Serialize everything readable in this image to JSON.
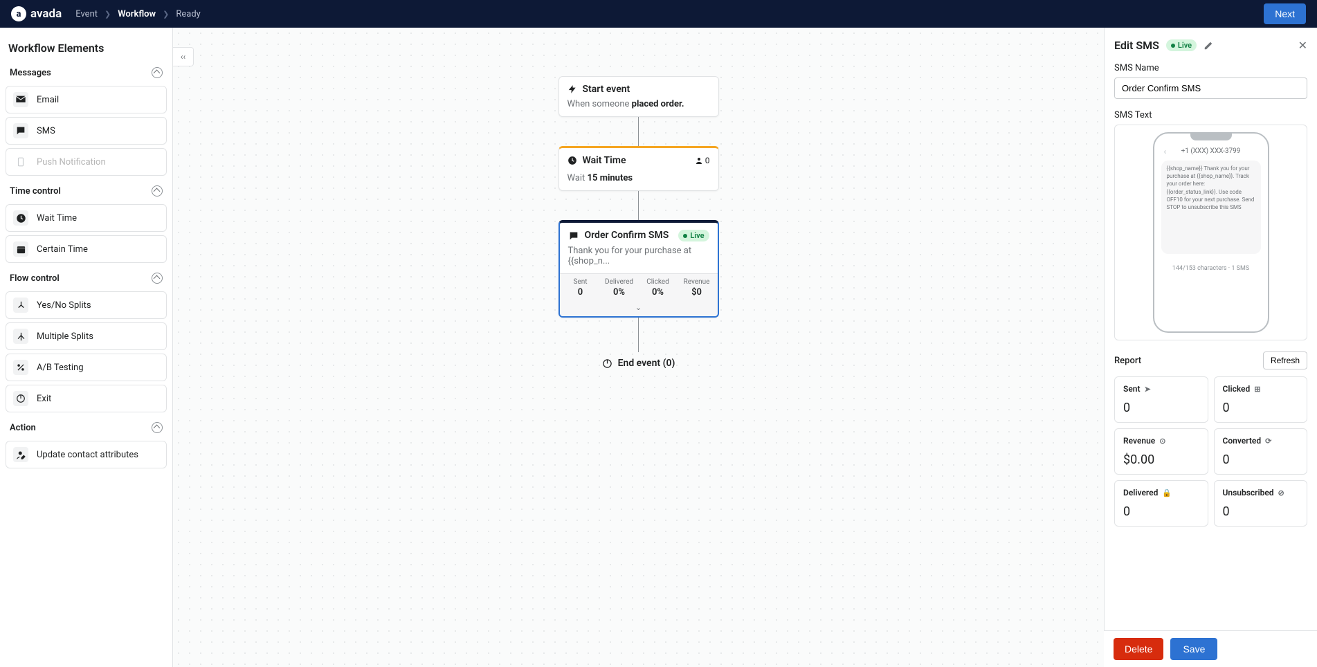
{
  "header": {
    "logo": "avada",
    "breadcrumbs": [
      "Event",
      "Workflow",
      "Ready"
    ],
    "next_button": "Next"
  },
  "sidebar": {
    "title": "Workflow Elements",
    "sections": [
      {
        "title": "Messages",
        "items": [
          {
            "label": "Email",
            "icon": "email",
            "disabled": false
          },
          {
            "label": "SMS",
            "icon": "sms",
            "disabled": false
          },
          {
            "label": "Push Notification",
            "icon": "push",
            "disabled": true
          }
        ]
      },
      {
        "title": "Time control",
        "items": [
          {
            "label": "Wait Time",
            "icon": "clock",
            "disabled": false
          },
          {
            "label": "Certain Time",
            "icon": "calendar",
            "disabled": false
          }
        ]
      },
      {
        "title": "Flow control",
        "items": [
          {
            "label": "Yes/No Splits",
            "icon": "split",
            "disabled": false
          },
          {
            "label": "Multiple Splits",
            "icon": "multisplit",
            "disabled": false
          },
          {
            "label": "A/B Testing",
            "icon": "percent",
            "disabled": false
          },
          {
            "label": "Exit",
            "icon": "power",
            "disabled": false
          }
        ]
      },
      {
        "title": "Action",
        "items": [
          {
            "label": "Update contact attributes",
            "icon": "user-edit",
            "disabled": false
          }
        ]
      }
    ]
  },
  "flow": {
    "start": {
      "title": "Start event",
      "desc_prefix": "When someone ",
      "desc_bold": "placed order."
    },
    "wait": {
      "title": "Wait Time",
      "people": "0",
      "desc_prefix": "Wait ",
      "desc_bold": "15 minutes"
    },
    "sms": {
      "title": "Order Confirm SMS",
      "status": "Live",
      "preview": "Thank you for your purchase at {{shop_n...",
      "stats": [
        {
          "label": "Sent",
          "value": "0"
        },
        {
          "label": "Delivered",
          "value": "0%"
        },
        {
          "label": "Clicked",
          "value": "0%"
        },
        {
          "label": "Revenue",
          "value": "$0"
        }
      ]
    },
    "end": {
      "label": "End event (0)"
    }
  },
  "editor": {
    "title": "Edit SMS",
    "status": "Live",
    "name_label": "SMS Name",
    "name_value": "Order Confirm SMS",
    "text_label": "SMS Text",
    "phone_number": "+1 (XXX) XXX-3799",
    "message_body": "{{shop_name}} Thank you for your purchase at {{shop_name}}. Track your order here: {{order_status_link}}. Use code OFF10 for your next purchase. Send STOP to unsubscribe this SMS",
    "char_count": "144/153 characters · 1 SMS",
    "report_label": "Report",
    "refresh_label": "Refresh",
    "report": [
      {
        "title": "Sent",
        "value": "0",
        "icon": "send"
      },
      {
        "title": "Clicked",
        "value": "0",
        "icon": "click"
      },
      {
        "title": "Revenue",
        "value": "$0.00",
        "icon": "dollar"
      },
      {
        "title": "Converted",
        "value": "0",
        "icon": "convert"
      },
      {
        "title": "Delivered",
        "value": "0",
        "icon": "lock"
      },
      {
        "title": "Unsubscribed",
        "value": "0",
        "icon": "unsub"
      }
    ],
    "delete_label": "Delete",
    "save_label": "Save"
  }
}
